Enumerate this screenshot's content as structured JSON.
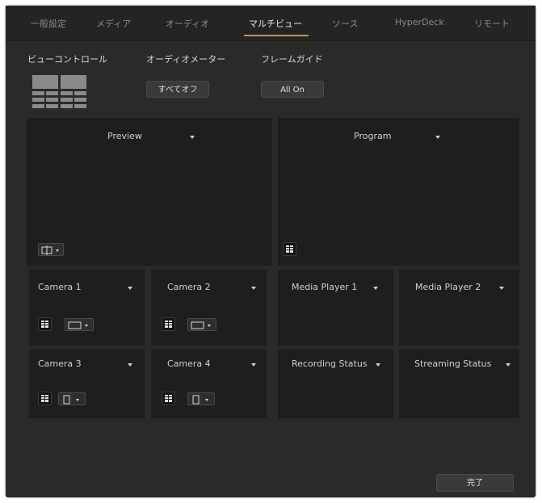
{
  "tabs": [
    {
      "label": "一般設定",
      "active": false
    },
    {
      "label": "メディア",
      "active": false
    },
    {
      "label": "オーディオ",
      "active": false
    },
    {
      "label": "マルチビュー",
      "active": true
    },
    {
      "label": "ソース",
      "active": false
    },
    {
      "label": "HyperDeck",
      "active": false
    },
    {
      "label": "リモート",
      "active": false
    }
  ],
  "controls": {
    "view_control_label": "ビューコントロール",
    "audio_meter_label": "オーディオメーター",
    "audio_meter_button": "すべてオフ",
    "frame_guide_label": "フレームガイド",
    "frame_guide_button": "All On"
  },
  "windows": [
    {
      "label": "Preview",
      "icon": "safe-area-icon"
    },
    {
      "label": "Program",
      "icon": "audio-meter-icon"
    },
    {
      "label": "Camera 1",
      "icon": "audio-meter-icon"
    },
    {
      "label": "Camera 2",
      "icon": "audio-meter-icon"
    },
    {
      "label": "Media Player 1",
      "icon": ""
    },
    {
      "label": "Media Player 2",
      "icon": ""
    },
    {
      "label": "Camera 3",
      "icon": "audio-meter-icon"
    },
    {
      "label": "Camera 4",
      "icon": "audio-meter-icon"
    },
    {
      "label": "Recording Status",
      "icon": ""
    },
    {
      "label": "Streaming Status",
      "icon": ""
    }
  ],
  "footer": {
    "done_button": "完了"
  },
  "colors": {
    "accent": "#e88a2a",
    "panel": "#2a2a2a",
    "window": "#1e1e1e"
  }
}
